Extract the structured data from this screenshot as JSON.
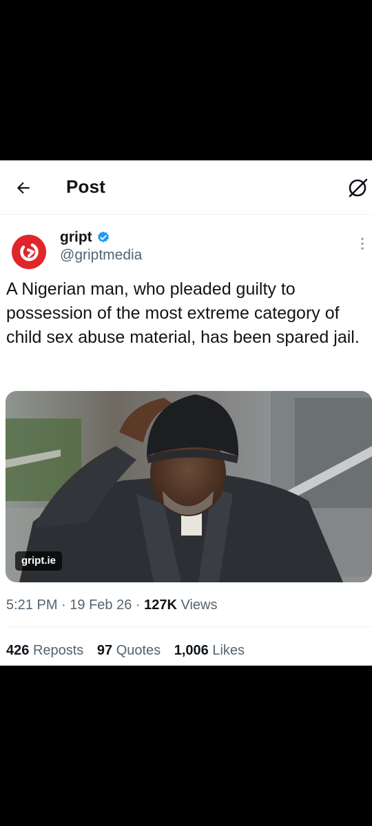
{
  "header": {
    "title": "Post",
    "back_icon": "arrow-left-icon",
    "grok_icon": "grok-icon"
  },
  "author": {
    "name": "gript",
    "handle": "@griptmedia",
    "verified_icon": "verified-badge-icon",
    "avatar_icon": "gript-logo-icon",
    "brand_color": "#e0262b"
  },
  "tweet": {
    "text": "A Nigerian man, who pleaded guilty to possession of the most extreme category of child sex abuse material, has been spared jail.",
    "media_watermark": "gript.ie"
  },
  "meta": {
    "time": "5:21 PM",
    "date": "19 Feb 26",
    "views_count": "127K",
    "views_label": "Views"
  },
  "stats": {
    "reposts_count": "426",
    "reposts_label": "Reposts",
    "quotes_count": "97",
    "quotes_label": "Quotes",
    "likes_count": "1,006",
    "likes_label": "Likes"
  },
  "colors": {
    "accent": "#1d9bf0",
    "secondary_text": "#536471"
  }
}
